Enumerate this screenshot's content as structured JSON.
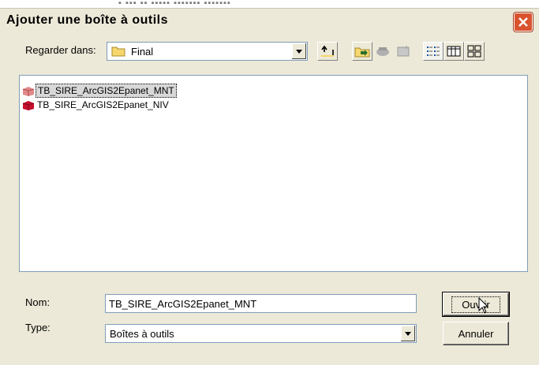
{
  "dialog": {
    "title": "Ajouter une boîte à outils"
  },
  "lookin": {
    "label": "Regarder dans:",
    "value": "Final"
  },
  "files": [
    {
      "name": "TB_SIRE_ArcGIS2Epanet_MNT",
      "selected": true
    },
    {
      "name": "TB_SIRE_ArcGIS2Epanet_NIV",
      "selected": false
    }
  ],
  "name_field": {
    "label": "Nom:",
    "value": "TB_SIRE_ArcGIS2Epanet_MNT"
  },
  "type_field": {
    "label": "Type:",
    "value": "Boîtes à outils"
  },
  "buttons": {
    "open": "Ouvrir",
    "cancel": "Annuler"
  },
  "icons": {
    "close": "close-icon",
    "folder": "folder-icon",
    "up": "up-folder-icon",
    "toolbox": "toolbox-icon"
  },
  "colors": {
    "window_bg": "#ece9d8",
    "close_red": "#d9532e",
    "toolbox_red": "#c8102e"
  }
}
